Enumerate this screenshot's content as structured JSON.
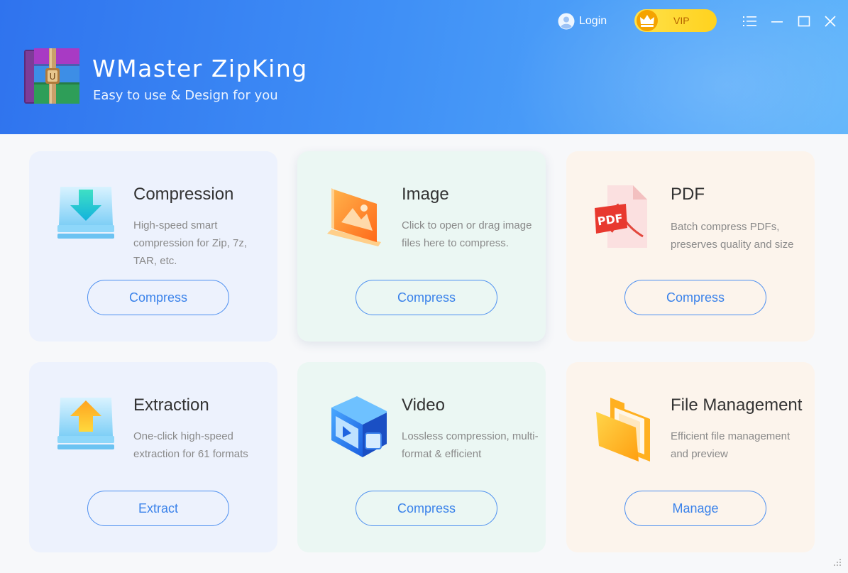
{
  "header": {
    "title": "WMaster ZipKing",
    "tagline": "Easy to use & Design for you",
    "login_label": "Login",
    "vip_label": "VIP",
    "icons": [
      "archive-logo-icon",
      "avatar-icon",
      "crown-icon",
      "menu-icon",
      "minimize-icon",
      "maximize-icon",
      "close-icon"
    ]
  },
  "cards": [
    {
      "title": "Compression",
      "description": "High-speed smart compression for Zip, 7z, TAR, etc.",
      "button": "Compress",
      "icon": "compress-tray-icon"
    },
    {
      "title": "Image",
      "description": "Click to open or drag image files here to compress.",
      "button": "Compress",
      "icon": "image-frame-icon"
    },
    {
      "title": "PDF",
      "description": "Batch compress PDFs, preserves quality and size",
      "button": "Compress",
      "icon": "pdf-file-icon"
    },
    {
      "title": "Extraction",
      "description": "One-click high-speed extraction for 61 formats",
      "button": "Extract",
      "icon": "extract-tray-icon"
    },
    {
      "title": "Video",
      "description": "Lossless compression, multi-format & efficient",
      "button": "Compress",
      "icon": "video-player-icon"
    },
    {
      "title": "File Management",
      "description": "Efficient file management and preview",
      "button": "Manage",
      "icon": "folder-icon"
    }
  ],
  "colors": {
    "header_start": "#2f73ee",
    "header_end": "#5cb3fb",
    "accent": "#3a82ea",
    "vip_gold": "#ffd21e",
    "card_blue": "#edf2fd",
    "card_green": "#ebf7f3",
    "card_orange": "#fcf4ec"
  }
}
